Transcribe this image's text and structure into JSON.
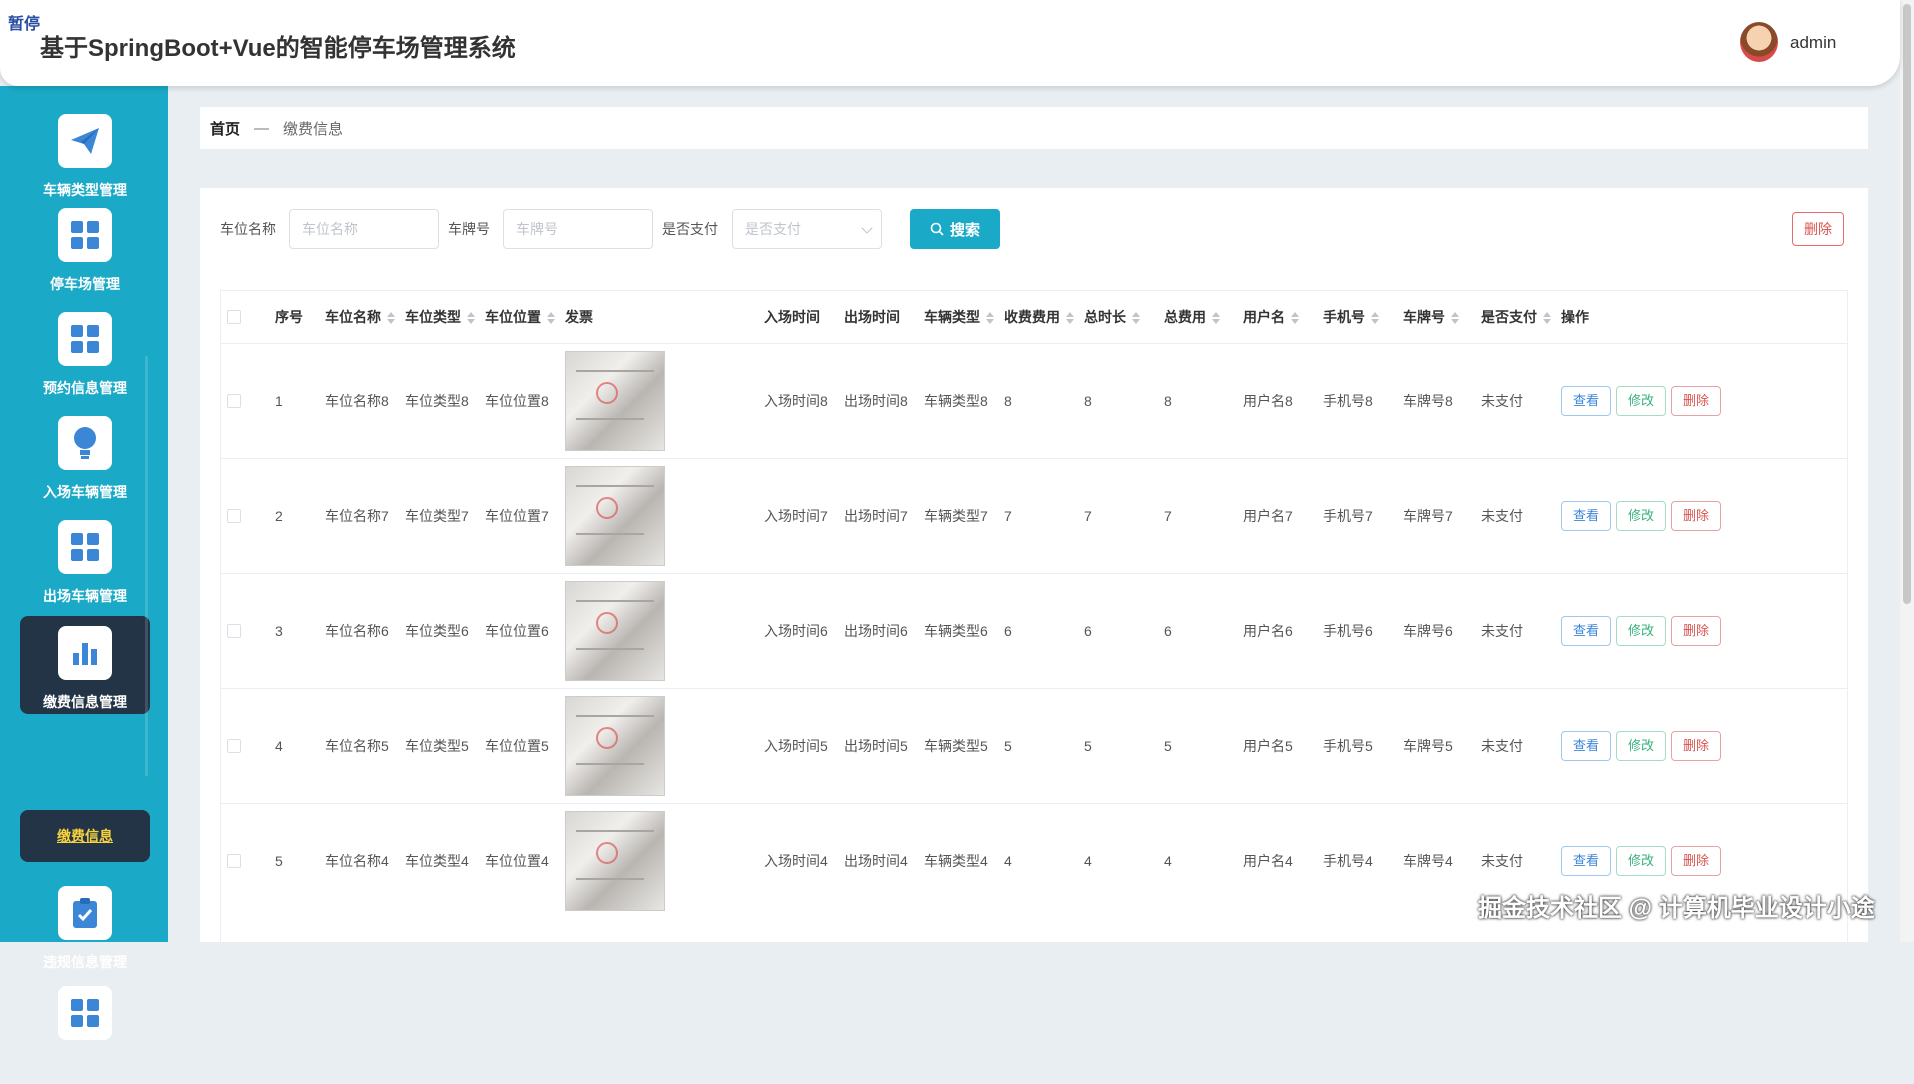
{
  "app": {
    "pause_tag": "暂停",
    "title": "基于SpringBoot+Vue的智能停车场管理系统",
    "username": "admin"
  },
  "sidebar": {
    "items": [
      {
        "label": "车辆类型管理",
        "icon": "paper-plane-icon"
      },
      {
        "label": "停车场管理",
        "icon": "grid-icon"
      },
      {
        "label": "预约信息管理",
        "icon": "grid-icon"
      },
      {
        "label": "入场车辆管理",
        "icon": "bulb-icon"
      },
      {
        "label": "出场车辆管理",
        "icon": "grid-icon"
      },
      {
        "label": "缴费信息管理",
        "icon": "bar-chart-icon"
      },
      {
        "label": "违规信息管理",
        "icon": "clipboard-check-icon"
      }
    ],
    "active_index": 5,
    "sub_item": "缴费信息"
  },
  "breadcrumb": {
    "home": "首页",
    "sep": "—",
    "current": "缴费信息"
  },
  "search": {
    "spot_label": "车位名称",
    "spot_placeholder": "车位名称",
    "plate_label": "车牌号",
    "plate_placeholder": "车牌号",
    "paid_label": "是否支付",
    "paid_placeholder": "是否支付",
    "button": "搜索"
  },
  "delete_label": "删除",
  "table": {
    "headers": {
      "index": "序号",
      "spot_name": "车位名称",
      "spot_type": "车位类型",
      "spot_pos": "车位位置",
      "invoice": "发票",
      "in_time": "入场时间",
      "out_time": "出场时间",
      "vehicle_type": "车辆类型",
      "fee": "收费费用",
      "duration": "总时长",
      "total": "总费用",
      "user": "用户名",
      "phone": "手机号",
      "plate": "车牌号",
      "paid": "是否支付",
      "ops": "操作"
    },
    "actions": {
      "view": "查看",
      "edit": "修改",
      "delete": "删除"
    },
    "rows": [
      {
        "index": "1",
        "spot_name": "车位名称8",
        "spot_type": "车位类型8",
        "spot_pos": "车位位置8",
        "in_time": "入场时间8",
        "out_time": "出场时间8",
        "vehicle_type": "车辆类型8",
        "fee": "8",
        "duration": "8",
        "total": "8",
        "user": "用户名8",
        "phone": "手机号8",
        "plate": "车牌号8",
        "paid": "未支付"
      },
      {
        "index": "2",
        "spot_name": "车位名称7",
        "spot_type": "车位类型7",
        "spot_pos": "车位位置7",
        "in_time": "入场时间7",
        "out_time": "出场时间7",
        "vehicle_type": "车辆类型7",
        "fee": "7",
        "duration": "7",
        "total": "7",
        "user": "用户名7",
        "phone": "手机号7",
        "plate": "车牌号7",
        "paid": "未支付"
      },
      {
        "index": "3",
        "spot_name": "车位名称6",
        "spot_type": "车位类型6",
        "spot_pos": "车位位置6",
        "in_time": "入场时间6",
        "out_time": "出场时间6",
        "vehicle_type": "车辆类型6",
        "fee": "6",
        "duration": "6",
        "total": "6",
        "user": "用户名6",
        "phone": "手机号6",
        "plate": "车牌号6",
        "paid": "未支付"
      },
      {
        "index": "4",
        "spot_name": "车位名称5",
        "spot_type": "车位类型5",
        "spot_pos": "车位位置5",
        "in_time": "入场时间5",
        "out_time": "出场时间5",
        "vehicle_type": "车辆类型5",
        "fee": "5",
        "duration": "5",
        "total": "5",
        "user": "用户名5",
        "phone": "手机号5",
        "plate": "车牌号5",
        "paid": "未支付"
      },
      {
        "index": "5",
        "spot_name": "车位名称4",
        "spot_type": "车位类型4",
        "spot_pos": "车位位置4",
        "in_time": "入场时间4",
        "out_time": "出场时间4",
        "vehicle_type": "车辆类型4",
        "fee": "4",
        "duration": "4",
        "total": "4",
        "user": "用户名4",
        "phone": "手机号4",
        "plate": "车牌号4",
        "paid": "未支付"
      }
    ]
  },
  "watermark": "掘金技术社区 @ 计算机毕业设计小途",
  "colors": {
    "sidebar": "#1aa9c6",
    "active": "#233447",
    "accent": "#1aa9c6",
    "danger": "#d9534f"
  }
}
